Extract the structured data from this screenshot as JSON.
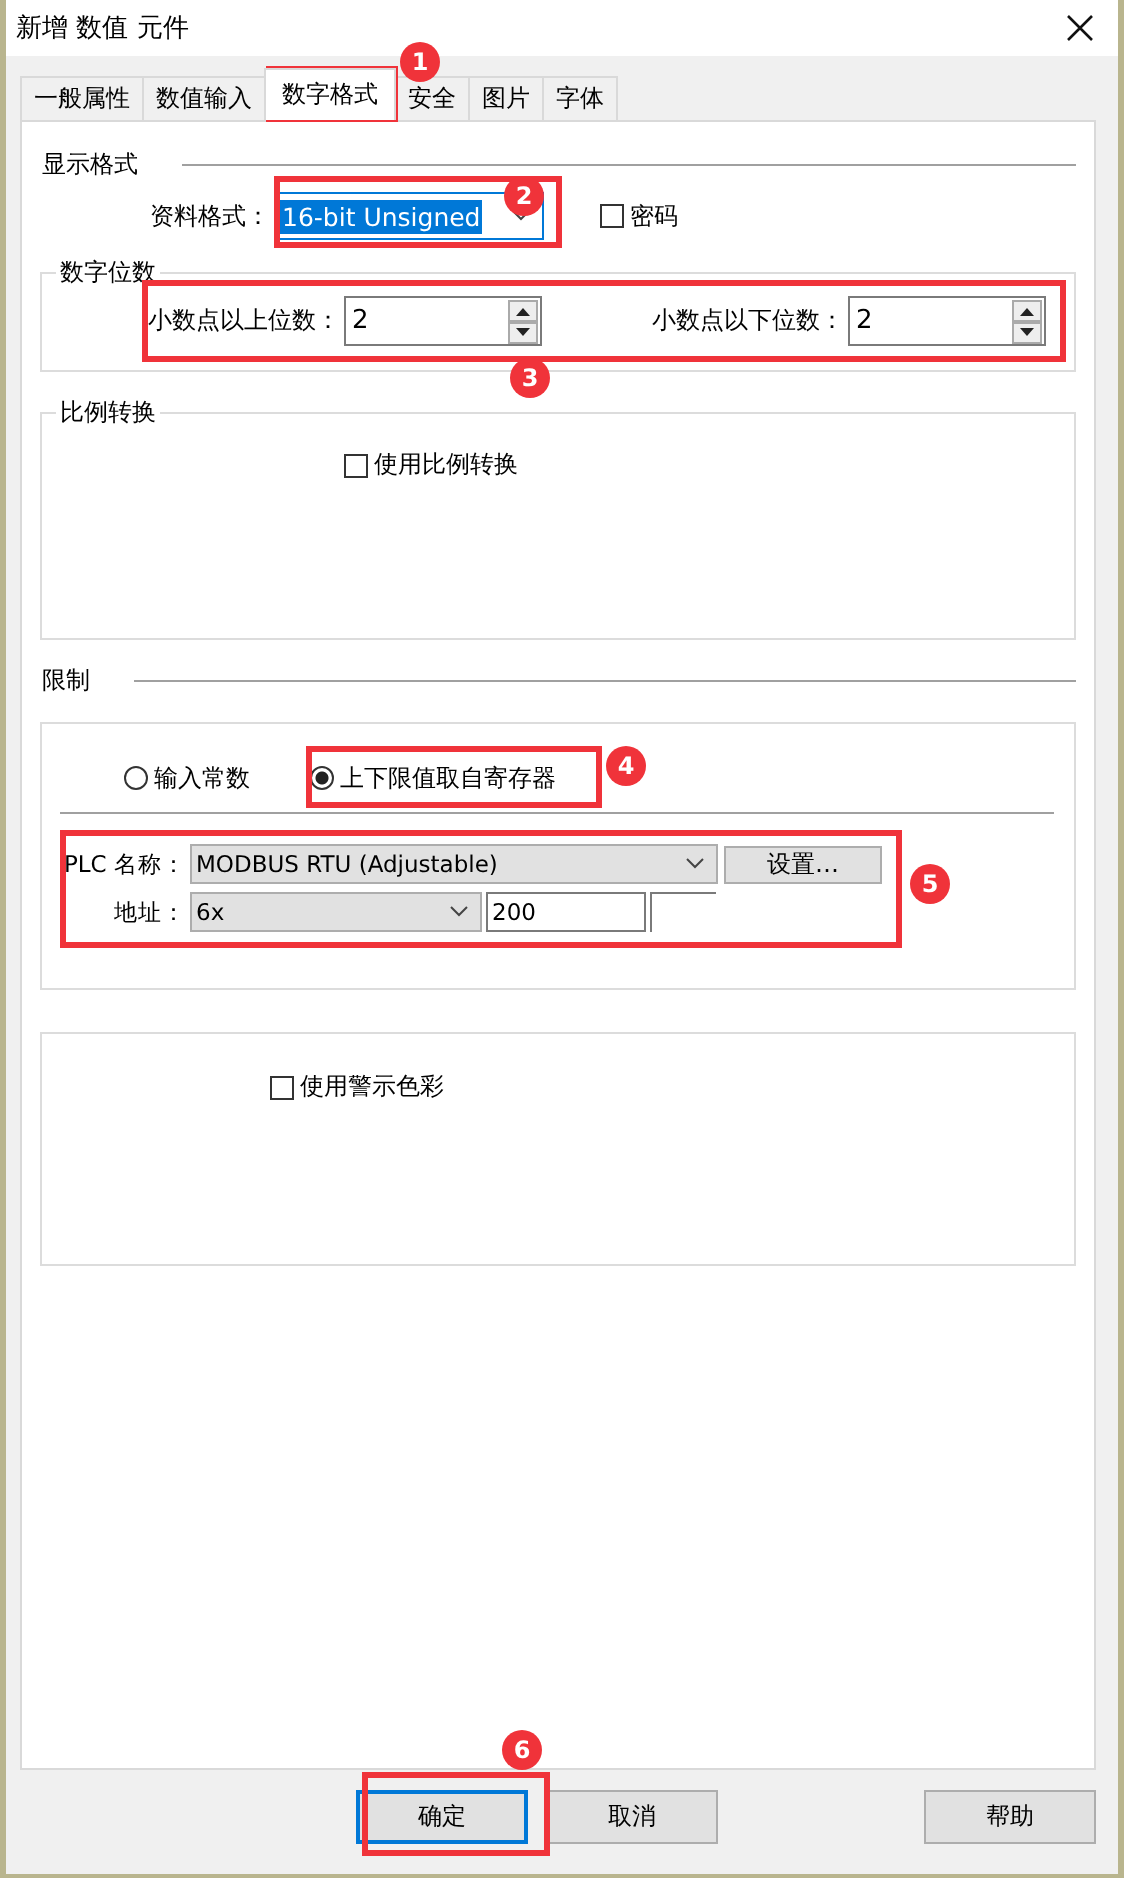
{
  "window": {
    "title": "新增 数值 元件"
  },
  "tabs": [
    {
      "label": "一般属性",
      "selected": false
    },
    {
      "label": "数值输入",
      "selected": false
    },
    {
      "label": "数字格式",
      "selected": true
    },
    {
      "label": "安全",
      "selected": false
    },
    {
      "label": "图片",
      "selected": false
    },
    {
      "label": "字体",
      "selected": false
    }
  ],
  "display_format": {
    "heading": "显示格式",
    "data_format_label": "资料格式：",
    "data_format_value": "16-bit Unsigned",
    "password": {
      "label": "密码",
      "checked": false
    }
  },
  "digits": {
    "heading": "数字位数",
    "integer_label": "小数点以上位数：",
    "integer_value": "2",
    "decimal_label": "小数点以下位数：",
    "decimal_value": "2"
  },
  "scaling": {
    "heading": "比例转换",
    "checkbox": {
      "label": "使用比例转换",
      "checked": false
    }
  },
  "limits": {
    "heading": "限制",
    "options": [
      {
        "label": "输入常数",
        "selected": false
      },
      {
        "label": "上下限值取自寄存器",
        "selected": true
      }
    ],
    "plc_label": "PLC 名称：",
    "plc_value": "MODBUS RTU (Adjustable)",
    "settings_button": "设置…",
    "address_label": "地址：",
    "address_type": "6x",
    "address_value": "200"
  },
  "alarm": {
    "checkbox": {
      "label": "使用警示色彩",
      "checked": false
    }
  },
  "buttons": [
    {
      "label": "确定",
      "kind": "default"
    },
    {
      "label": "取消",
      "kind": "normal"
    },
    {
      "label": "帮助",
      "kind": "normal"
    }
  ],
  "annotations": [
    {
      "number": "1"
    },
    {
      "number": "2"
    },
    {
      "number": "3"
    },
    {
      "number": "4"
    },
    {
      "number": "5"
    },
    {
      "number": "6"
    }
  ]
}
